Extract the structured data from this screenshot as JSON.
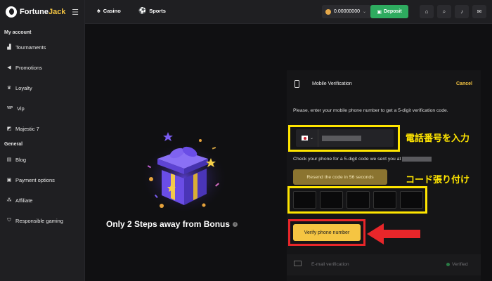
{
  "brand": {
    "name_part1": "Fortune",
    "name_part2": "Jack"
  },
  "sidebar": {
    "section_account": "My account",
    "section_general": "General",
    "items": [
      {
        "label": "Tournaments",
        "icon": "podium-icon"
      },
      {
        "label": "Promotions",
        "icon": "megaphone-icon"
      },
      {
        "label": "Loyalty",
        "icon": "crown-icon"
      },
      {
        "label": "Vip",
        "icon": "vip-icon"
      },
      {
        "label": "Majestic 7",
        "icon": "seven-icon"
      },
      {
        "label": "Blog",
        "icon": "document-icon"
      },
      {
        "label": "Payment options",
        "icon": "wallet-icon"
      },
      {
        "label": "Affiliate",
        "icon": "network-icon"
      },
      {
        "label": "Responsible gaming",
        "icon": "shield-icon"
      }
    ]
  },
  "header": {
    "nav_casino": "Casino",
    "nav_sports": "Sports",
    "balance": "0.00000000",
    "deposit_label": "Deposit"
  },
  "promo": {
    "title": "Only 2 Steps away from Bonus"
  },
  "verification": {
    "title": "Mobile Verification",
    "cancel_label": "Cancel",
    "instructions": "Please, enter your mobile phone number to get a 5-digit verification code.",
    "check_text": "Check your phone for a 5-digit code we sent you at",
    "resend_label": "Resend the code in 56 seconds",
    "verify_label": "Verify phone number",
    "email_label": "E-mail verification",
    "verified_label": "Verified"
  },
  "annotations": {
    "phone_input_note": "電話番号を入力",
    "code_note": "コード張り付け"
  },
  "colors": {
    "accent": "#f5c542",
    "deposit": "#2eab5f",
    "highlight": "#ffe500",
    "arrow": "#e8262a"
  }
}
